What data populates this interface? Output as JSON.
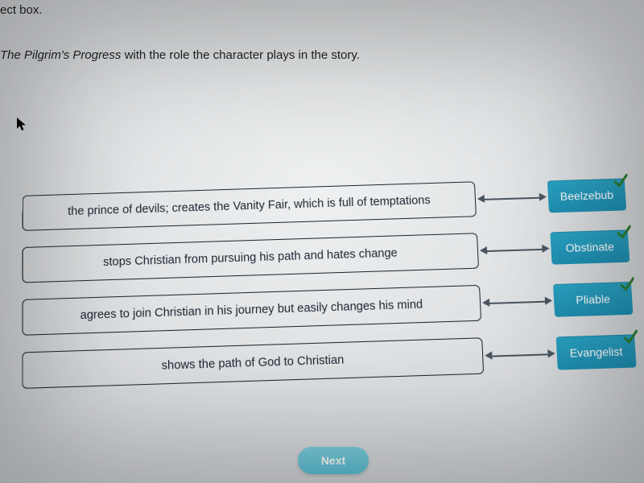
{
  "header_fragment": "ect box.",
  "instruction_prefix": "",
  "instruction_title_italic": "The Pilgrim's Progress",
  "instruction_suffix": " with the role the character plays in the story.",
  "rows": [
    {
      "description": "the prince of devils; creates the Vanity Fair, which is full of temptations",
      "name": "Beelzebub",
      "correct": true
    },
    {
      "description": "stops Christian from pursuing his path and hates change",
      "name": "Obstinate",
      "correct": true
    },
    {
      "description": "agrees to join Christian in his journey but easily changes his mind",
      "name": "Pliable",
      "correct": true
    },
    {
      "description": "shows the path of God to Christian",
      "name": "Evangelist",
      "correct": true
    }
  ],
  "next_label": "Next",
  "colors": {
    "name_box": "#1f90b3",
    "check": "#2e7d32",
    "next_bg": "#5cc3d7"
  }
}
